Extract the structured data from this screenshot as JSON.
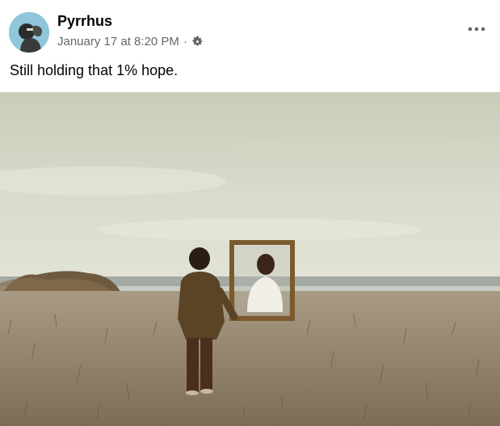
{
  "post": {
    "author": "Pyrrhus",
    "timestamp": "January 17 at 8:20 PM",
    "separator": "·",
    "text": "Still holding that 1% hope.",
    "privacy_icon": "gear-icon",
    "menu_icon": "more-options-icon"
  },
  "colors": {
    "author_text": "#050505",
    "meta_text": "#65676b",
    "avatar_bg": "#8fc6da"
  }
}
